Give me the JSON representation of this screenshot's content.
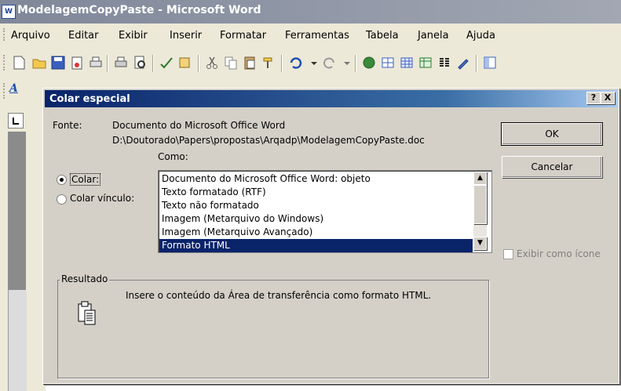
{
  "word_window": {
    "title": "ModelagemCopyPaste - Microsoft Word",
    "menu": [
      "Arquivo",
      "Editar",
      "Exibir",
      "Inserir",
      "Formatar",
      "Ferramentas",
      "Tabela",
      "Janela",
      "Ajuda"
    ]
  },
  "dialog": {
    "title": "Colar especial",
    "help_button": "?",
    "close_button": "X",
    "source_label": "Fonte:",
    "source_line1": "Documento do Microsoft Office Word",
    "source_line2": "D:\\Doutorado\\Papers\\propostas\\Arqadp\\ModelagemCopyPaste.doc",
    "as_label": "Como:",
    "paste_option": "Colar:",
    "paste_link_option": "Colar vínculo:",
    "list_items": [
      "Documento do Microsoft Office Word: objeto",
      "Texto formatado (RTF)",
      "Texto não formatado",
      "Imagem (Metarquivo do Windows)",
      "Imagem (Metarquivo Avançado)",
      "Formato HTML"
    ],
    "ok_button": "OK",
    "cancel_button": "Cancelar",
    "display_as_icon": "Exibir como ícone",
    "result_label": "Resultado",
    "result_text": "Insere o conteúdo da Área de transferência como formato HTML."
  },
  "colors": {
    "title_active": "#0a246a",
    "selection": "#0a246a",
    "dialog_bg": "#d4d0c8"
  }
}
